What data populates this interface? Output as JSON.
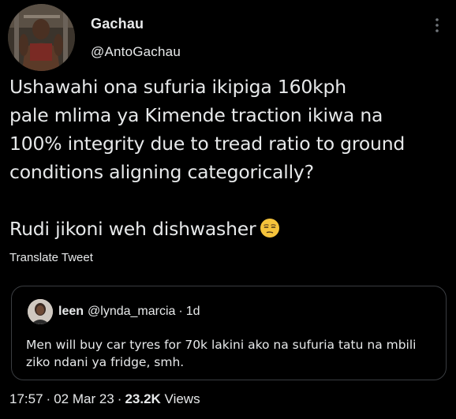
{
  "author": {
    "display_name": "Gachau",
    "handle": "@AntoGachau"
  },
  "icons": {
    "more": "more-vertical-icon",
    "emoji": "unamused-face-emoji"
  },
  "tweet": {
    "lines": [
      "Ushawahi ona sufuria ikipiga 160kph",
      "pale mlima ya Kimende traction ikiwa na",
      "100% integrity due to tread ratio to ground",
      "conditions aligning categorically?"
    ],
    "second_paragraph": "Rudi jikoni weh dishwasher",
    "translate_label": "Translate Tweet"
  },
  "quoted_tweet": {
    "display_name": "leen",
    "handle": "@lynda_marcia",
    "separator": "·",
    "time": "1d",
    "text": "Men will buy car tyres for 70k lakini ako na sufuria tatu na mbili ziko ndani ya fridge, smh."
  },
  "meta": {
    "time": "17:57",
    "separator": "·",
    "date": "02 Mar 23",
    "views_count": "23.2K",
    "views_label": "Views"
  },
  "colors": {
    "background": "#000000",
    "text": "#e7e9ea",
    "border": "#3a3d41"
  }
}
